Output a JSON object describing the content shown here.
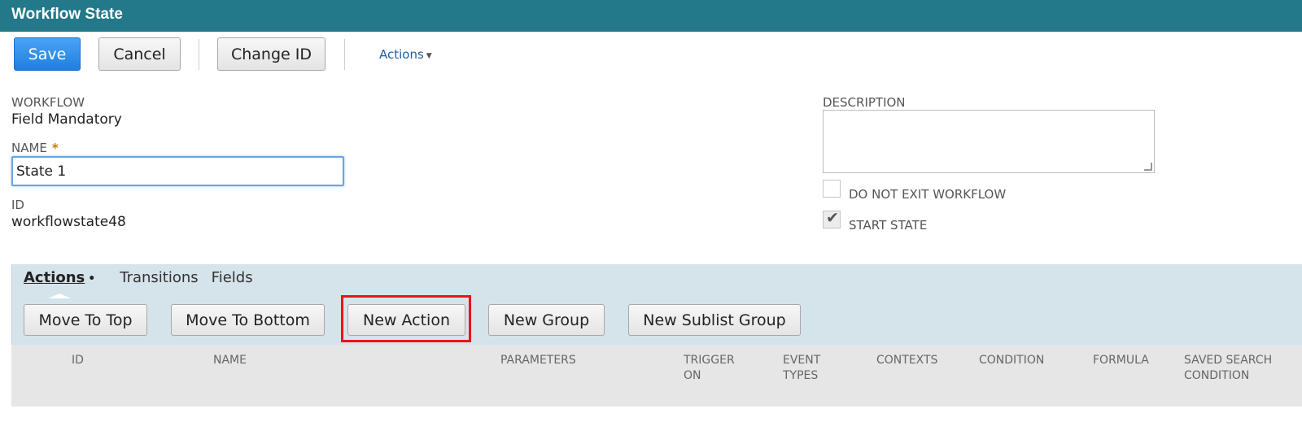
{
  "window": {
    "title": "Workflow State"
  },
  "toolbar": {
    "save_label": "Save",
    "cancel_label": "Cancel",
    "change_id_label": "Change ID",
    "actions_label": "Actions"
  },
  "form": {
    "workflow": {
      "label": "WORKFLOW",
      "value": "Field Mandatory"
    },
    "name": {
      "label": "NAME",
      "required_mark": "*",
      "value": "State 1"
    },
    "id": {
      "label": "ID",
      "value": "workflowstate48"
    },
    "description": {
      "label": "DESCRIPTION",
      "value": ""
    },
    "do_not_exit": {
      "label": "DO NOT EXIT WORKFLOW",
      "checked": false
    },
    "start_state": {
      "label": "START STATE",
      "checked": true
    }
  },
  "subtabs": {
    "tabs": [
      {
        "label": "Actions",
        "active": true,
        "dot": "•"
      },
      {
        "label": "Transitions",
        "active": false
      },
      {
        "label": "Fields",
        "active": false
      }
    ],
    "buttons": {
      "move_top": "Move To Top",
      "move_bottom": "Move To Bottom",
      "new_action": "New Action",
      "new_group": "New Group",
      "new_sublist_group": "New Sublist Group"
    },
    "columns": {
      "id": "ID",
      "name": "NAME",
      "parameters": "PARAMETERS",
      "trigger_on": "TRIGGER ON",
      "event_types": "EVENT TYPES",
      "contexts": "CONTEXTS",
      "condition": "CONDITION",
      "formula": "FORMULA",
      "saved_search_condition": "SAVED SEARCH CONDITION"
    }
  },
  "colors": {
    "titlebar": "#23788a",
    "primary": "#1f7fe0",
    "highlight": "#e8141c",
    "link": "#1d5fa8"
  }
}
